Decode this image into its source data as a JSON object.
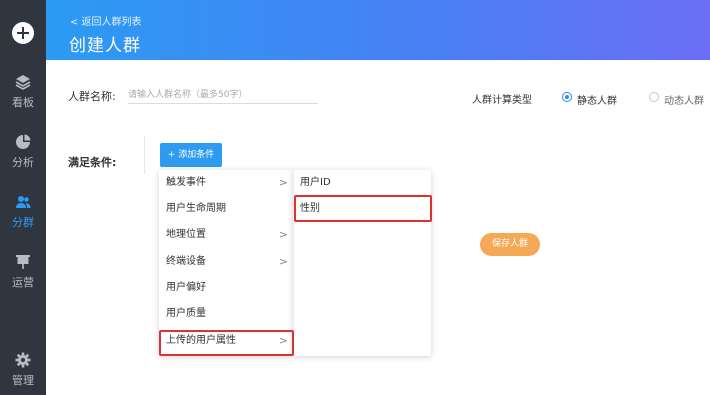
{
  "sidebar": {
    "items": [
      {
        "label": "看板",
        "icon": "layers-icon"
      },
      {
        "label": "分析",
        "icon": "pie-chart-icon"
      },
      {
        "label": "分群",
        "icon": "users-icon"
      },
      {
        "label": "运营",
        "icon": "presentation-icon"
      },
      {
        "label": "管理",
        "icon": "gear-icon"
      }
    ],
    "active_color": "#2d9cf0"
  },
  "header": {
    "back_link": "< 返回人群列表",
    "title": "创建人群"
  },
  "form": {
    "name_label": "人群名称:",
    "name_placeholder": "请输入人群名称（最多50字）",
    "calc_type_label": "人群计算类型",
    "radio_static": "静态人群",
    "radio_dynamic": "动态人群",
    "satisfy_label": "满足条件:",
    "add_condition": "+ 添加条件",
    "save_label": "保存人群"
  },
  "menu": {
    "level1": [
      "触发事件",
      "用户生命周期",
      "地理位置",
      "终端设备",
      "用户偏好",
      "用户质量",
      "上传的用户属性"
    ],
    "level2": [
      "用户ID",
      "性别"
    ]
  },
  "colors": {
    "highlight": "#e03131",
    "primary": "#2d9cf0",
    "save": "#f5a856"
  }
}
